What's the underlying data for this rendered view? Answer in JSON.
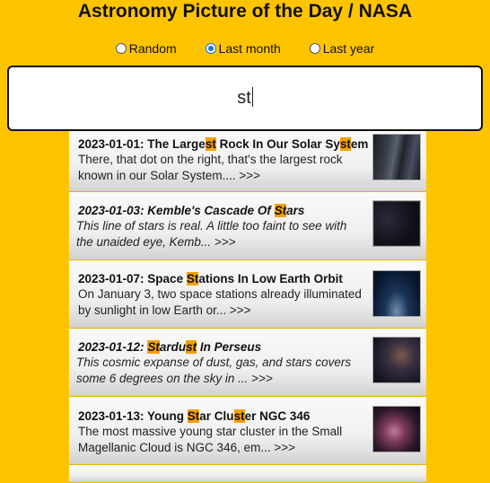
{
  "title": "Astronomy Picture of the Day / NASA",
  "filters": [
    {
      "label": "Random",
      "checked": false
    },
    {
      "label": "Last month",
      "checked": true
    },
    {
      "label": "Last year",
      "checked": false
    }
  ],
  "search": {
    "value": "st"
  },
  "results": [
    {
      "date": "2023-01-01",
      "head_parts": [
        "2023-01-01: The Large",
        "st",
        " Rock In Our Solar Sy",
        "st",
        "em"
      ],
      "desc": "There, that dot on the right, that's the largest rock known in our Solar System.... >>>"
    },
    {
      "date": "2023-01-03",
      "head_parts": [
        "2023-01-03: Kemble's Cascade Of ",
        "St",
        "ars"
      ],
      "desc": "This line of stars is real. A little too faint to see with the unaided eye, Kemb... >>>"
    },
    {
      "date": "2023-01-07",
      "head_parts": [
        "2023-01-07: Space ",
        "St",
        "ations In Low Earth Orbit"
      ],
      "desc": "On January 3, two space stations already illuminated by sunlight in low Earth or... >>>"
    },
    {
      "date": "2023-01-12",
      "head_parts": [
        "2023-01-12: ",
        "St",
        "ardu",
        "st",
        " In Perseus"
      ],
      "desc": "This cosmic expanse of dust, gas, and stars covers some 6 degrees on the sky in ... >>>"
    },
    {
      "date": "2023-01-13",
      "head_parts": [
        "2023-01-13: Young ",
        "St",
        "ar Clu",
        "st",
        "er NGC 346"
      ],
      "desc": "The most massive young star cluster in the Small Magellanic Cloud is NGC 346, em... >>>"
    }
  ]
}
